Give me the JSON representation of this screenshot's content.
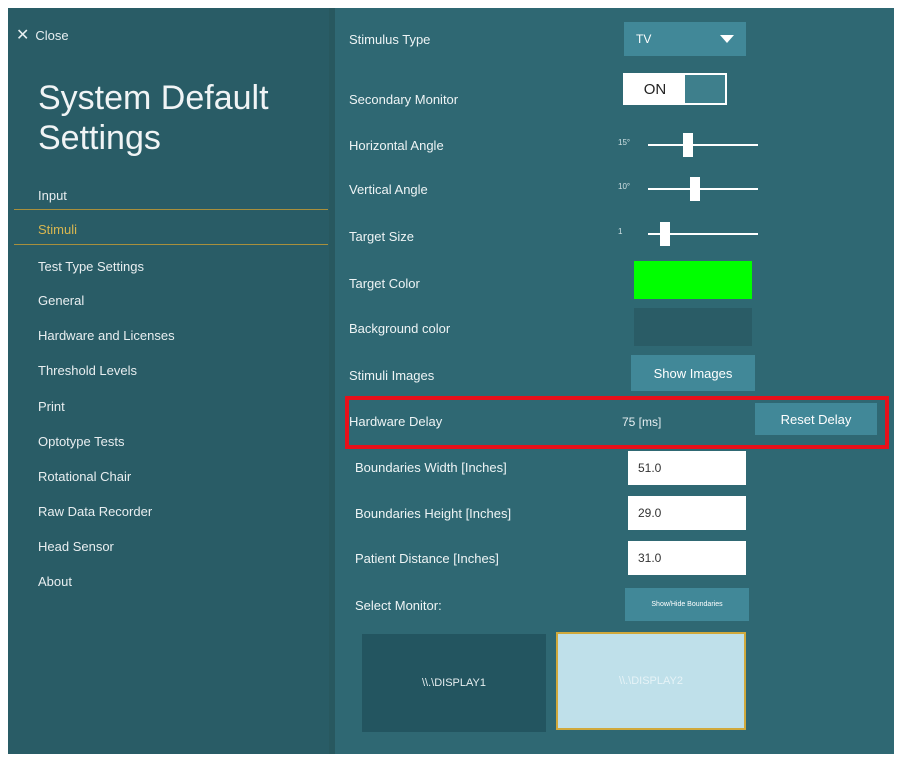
{
  "sidebar": {
    "close_label": "Close",
    "title_line1": "System Default",
    "title_line2": "Settings",
    "items": [
      {
        "label": "Input"
      },
      {
        "label": "Stimuli",
        "active": true
      },
      {
        "label": "Test Type Settings"
      },
      {
        "label": "General"
      },
      {
        "label": "Hardware and Licenses"
      },
      {
        "label": "Threshold Levels"
      },
      {
        "label": "Print"
      },
      {
        "label": "Optotype Tests"
      },
      {
        "label": "Rotational Chair"
      },
      {
        "label": "Raw Data Recorder"
      },
      {
        "label": "Head Sensor"
      },
      {
        "label": "About"
      }
    ]
  },
  "settings": {
    "stimulus_type": {
      "label": "Stimulus Type",
      "value": "TV"
    },
    "secondary_monitor": {
      "label": "Secondary Monitor",
      "value": "ON"
    },
    "horizontal_angle": {
      "label": "Horizontal Angle",
      "tick": "15°",
      "level": 0.35
    },
    "vertical_angle": {
      "label": "Vertical Angle",
      "tick": "10°",
      "level": 0.42
    },
    "target_size": {
      "label": "Target Size",
      "tick": "1",
      "level": 0.12
    },
    "target_color": {
      "label": "Target Color",
      "color": "#00ff00"
    },
    "background_color": {
      "label": "Background color",
      "color": "#2a5c66"
    },
    "stimuli_images": {
      "label": "Stimuli Images",
      "button": "Show Images"
    },
    "hardware_delay": {
      "label": "Hardware Delay",
      "value": "75 [ms]",
      "button": "Reset Delay"
    },
    "boundaries_width": {
      "label": "Boundaries Width  [Inches]",
      "value": "51.0"
    },
    "boundaries_height": {
      "label": "Boundaries Height  [Inches]",
      "value": "29.0"
    },
    "patient_distance": {
      "label": "Patient Distance  [Inches]",
      "value": "31.0"
    },
    "select_monitor": {
      "label": "Select Monitor:",
      "button": "Show/Hide Boundaries"
    }
  },
  "monitors": [
    {
      "label": "\\\\.\\DISPLAY1"
    },
    {
      "label": "\\\\.\\DISPLAY2"
    }
  ],
  "colors": {
    "accent": "#418898",
    "active_nav": "#d7b650",
    "highlight": "#e8101a"
  }
}
